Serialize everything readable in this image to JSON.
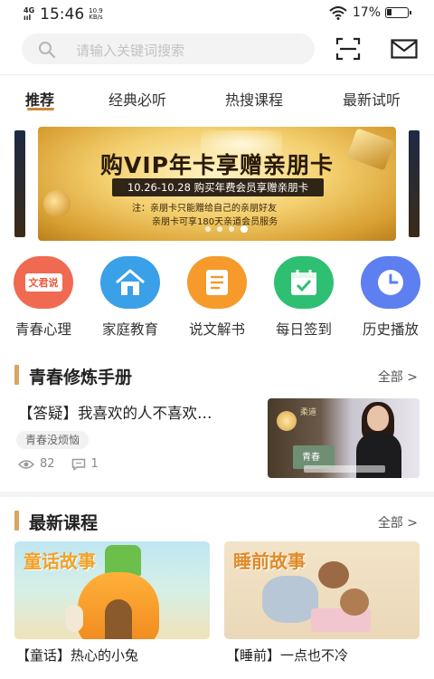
{
  "status_bar": {
    "network": "4G",
    "signal": "ııl",
    "time": "15:46",
    "speed_value": "10.9",
    "speed_unit": "KB/s",
    "battery": "17%"
  },
  "search": {
    "placeholder": "请输入关键词搜索"
  },
  "tabs": [
    {
      "label": "推荐",
      "active": true
    },
    {
      "label": "经典必听",
      "active": false
    },
    {
      "label": "热搜课程",
      "active": false
    },
    {
      "label": "最新试听",
      "active": false
    }
  ],
  "banner": {
    "title": "购VIP年卡享赠亲朋卡",
    "subtitle": "10.26-10.28 购买年费会员享赠亲朋卡",
    "note1": "注：亲朋卡只能赠给自己的亲朋好友",
    "note2": "亲朋卡可享180天亲道会员服务",
    "slide_count": 4,
    "active_slide": 4
  },
  "categories": [
    {
      "label": "青春心理",
      "badge": "文君说",
      "color": "#f06a52",
      "icon": "text-badge-icon"
    },
    {
      "label": "家庭教育",
      "color": "#3aa0e8",
      "icon": "house-icon"
    },
    {
      "label": "说文解书",
      "color": "#f59a2b",
      "icon": "document-icon"
    },
    {
      "label": "每日签到",
      "color": "#2fbf73",
      "icon": "calendar-check-icon"
    },
    {
      "label": "历史播放",
      "color": "#5d7ff0",
      "icon": "clock-icon"
    }
  ],
  "section1": {
    "title": "青春修炼手册",
    "more": "全部 >",
    "article": {
      "title": "【答疑】我喜欢的人不喜欢…",
      "tag": "青春没烦恼",
      "views": "82",
      "comments": "1",
      "thumb_text1": "柔道",
      "thumb_text2": "青春"
    }
  },
  "section2": {
    "title": "最新课程",
    "more": "全部 >",
    "courses": [
      {
        "title": "【童话】热心的小兔",
        "image_label": "童话故事"
      },
      {
        "title": "【睡前】一点也不冷",
        "image_label": "睡前故事"
      }
    ]
  },
  "colors": {
    "accent": "#c98a3a",
    "section_bar": "#d7a55c"
  }
}
